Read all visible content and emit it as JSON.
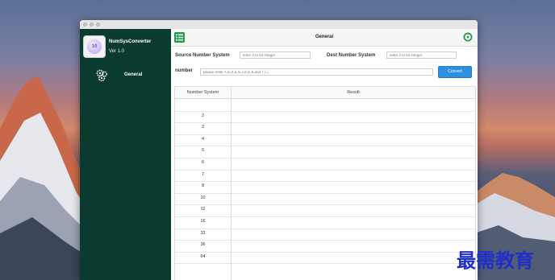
{
  "app": {
    "name": "NumSysConverter",
    "version": "Ver 1.0",
    "icon_text": "10"
  },
  "sidebar": {
    "items": [
      {
        "label": "General",
        "icon": "gear-cluster-icon"
      }
    ]
  },
  "header": {
    "title": "General",
    "left_icon": "menu-icon",
    "right_icon": "refresh-icon"
  },
  "form": {
    "source_label": "Source Number System",
    "source_placeholder": "enter 2 to 64 integer",
    "dest_label": "Dest Number System",
    "dest_placeholder": "enter 2 to 64 integer",
    "number_label": "number",
    "number_placeholder": "please enter A to Z,a to z,0 to 9,and +,/,=",
    "convert_label": "Convert"
  },
  "table": {
    "headers": [
      "Number System",
      "Result"
    ],
    "rows": [
      "",
      "2",
      "3",
      "4",
      "5",
      "6",
      "7",
      "8",
      "10",
      "12",
      "16",
      "32",
      "36",
      "64"
    ]
  },
  "watermark": "最需教育",
  "colors": {
    "sidebar": "#0a3a30",
    "accent": "#2e8fe0",
    "icon_green": "#1e9e4a"
  }
}
